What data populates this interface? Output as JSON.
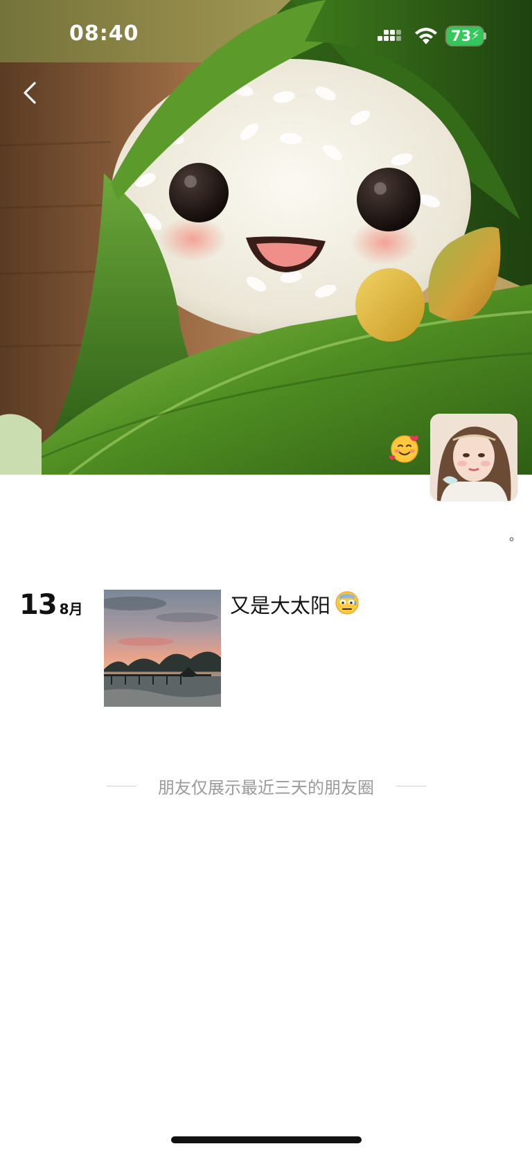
{
  "status_bar": {
    "time": "08:40",
    "battery_level": "73",
    "battery_charging_glyph": "⚡",
    "icons": [
      "signal-icon",
      "wifi-icon",
      "battery-icon"
    ]
  },
  "nav": {
    "back_icon": "chevron-left-icon"
  },
  "cover": {
    "description_icon": "zongzi-cover-image"
  },
  "profile": {
    "status_emoji": "🥰",
    "signature": "。"
  },
  "post": {
    "day": "13",
    "month": "8月",
    "text": "又是大太阳",
    "text_emoji": "😓"
  },
  "footer": {
    "limit_note": "朋友仅展示最近三天的朋友圈"
  },
  "colors": {
    "leaf_green": "#4d8a26",
    "rice_white": "#f3f0e6",
    "battery_green": "#34c759",
    "muted_text": "#9a9a9a"
  }
}
